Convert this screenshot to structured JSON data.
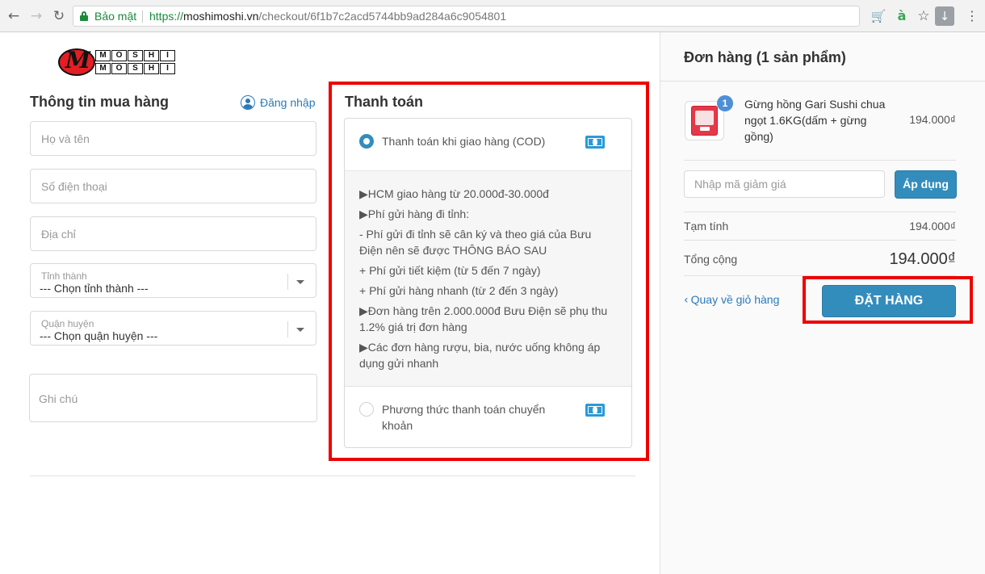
{
  "browser": {
    "back_icon": "←",
    "forward_icon": "→",
    "reload_icon": "↻",
    "secure_label": "Bảo mật",
    "url_scheme": "https://",
    "url_host": "moshimoshi.vn",
    "url_path": "/checkout/6f1b7c2acd5744bb9ad284a6c9054801",
    "cart_ext_icon": "🛒",
    "ext_a_icon": "à",
    "star_icon": "☆",
    "download_icon": "↓",
    "menu_icon": "⋮"
  },
  "logo": {
    "row1": [
      "M",
      "O",
      "S",
      "H",
      "I"
    ],
    "row2": [
      "M",
      "O",
      "S",
      "H",
      "I"
    ],
    "mark": "M"
  },
  "buyer": {
    "title": "Thông tin mua hàng",
    "login_label": "Đăng nhập",
    "name_placeholder": "Họ và tên",
    "phone_placeholder": "Số điện thoại",
    "address_placeholder": "Địa chỉ",
    "province": {
      "label": "Tỉnh thành",
      "value": "--- Chọn tỉnh thành ---"
    },
    "district": {
      "label": "Quận huyện",
      "value": "--- Chọn quận huyện ---"
    },
    "note_placeholder": "Ghi chú"
  },
  "payment": {
    "title": "Thanh toán",
    "cod_label": "Thanh toán khi giao hàng (COD)",
    "details": [
      "▶HCM giao hàng từ 20.000đ-30.000đ",
      "▶Phí gửi hàng đi tỉnh:",
      "- Phí gửi đi tỉnh sẽ cân ký và theo giá của Bưu Điện nên sẽ được THÔNG BÁO SAU",
      "+ Phí gửi tiết kiệm (từ 5 đến 7 ngày)",
      "+ Phí gửi hàng nhanh (từ 2 đến 3 ngày)",
      "▶Đơn hàng trên 2.000.000đ Bưu Điện sẽ phụ thu 1.2% giá trị đơn hàng",
      "▶Các đơn hàng rượu, bia, nước uống không áp dụng gửi nhanh"
    ],
    "transfer_label": "Phương thức thanh toán chuyển khoản"
  },
  "order": {
    "title": "Đơn hàng (1 sản phẩm)",
    "product": {
      "quantity": "1",
      "name": "Gừng hồng Gari Sushi chua ngọt 1.6KG(dấm + gừng gồng)",
      "price": "194.000₫"
    },
    "discount_placeholder": "Nhập mã giảm giá",
    "apply_label": "Áp dụng",
    "subtotal_label": "Tạm tính",
    "subtotal_value": "194.000₫",
    "total_label": "Tổng cộng",
    "total_value": "194.000₫",
    "back_chevron": "‹",
    "back_label": "Quay về giỏ hàng",
    "order_button": "ĐẶT HÀNG"
  }
}
